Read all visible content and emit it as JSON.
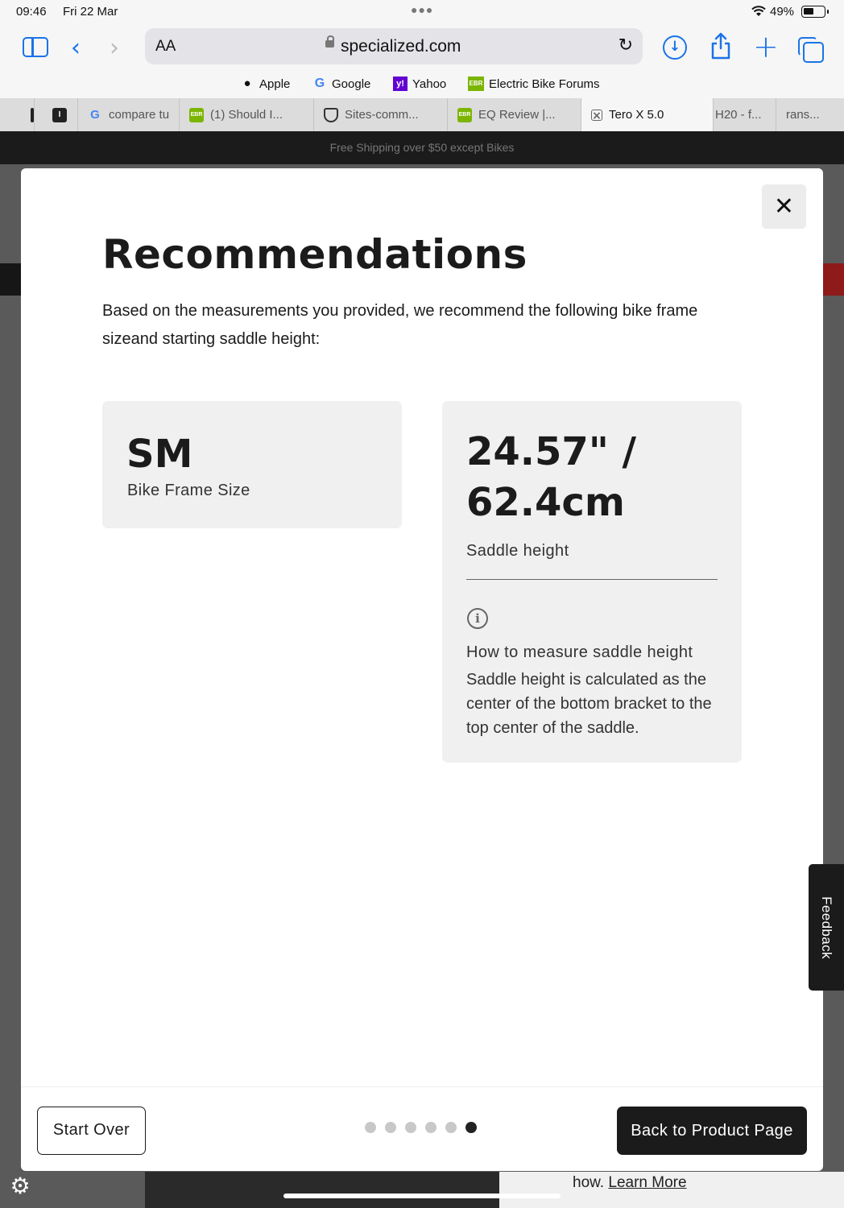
{
  "status": {
    "time": "09:46",
    "date": "Fri 22 Mar",
    "battery": "49%"
  },
  "toolbar": {
    "aa": "AA",
    "url": "specialized.com"
  },
  "favorites": [
    {
      "label": "Apple",
      "icon": "apple-icon"
    },
    {
      "label": "Google",
      "icon": "google-icon"
    },
    {
      "label": "Yahoo",
      "icon": "yahoo-icon"
    },
    {
      "label": "Electric Bike Forums",
      "icon": "ebr-icon"
    }
  ],
  "tabs": [
    {
      "label": "compare tu",
      "icon": "google-icon"
    },
    {
      "label": "(1) Should I...",
      "icon": "ebr-icon"
    },
    {
      "label": "Sites-comm...",
      "icon": "shield-icon"
    },
    {
      "label": "EQ Review |...",
      "icon": "ebr-icon"
    },
    {
      "label": "Tero X 5.0",
      "icon": "close-tab-icon",
      "active": true
    },
    {
      "label": "H20 - f..."
    },
    {
      "label": "rans..."
    }
  ],
  "page": {
    "shipping_banner": "Free Shipping over $50 except Bikes",
    "learn_prefix": "how.",
    "learn_link": "Learn More"
  },
  "modal": {
    "title": "Recommendations",
    "intro": "Based on the measurements you provided, we recommend the following bike frame sizeand starting saddle height:",
    "frame": {
      "value": "SM",
      "label": "Bike Frame Size"
    },
    "saddle": {
      "value": "24.57\" / 62.4cm",
      "label": "Saddle height",
      "how_title": "How to measure saddle height",
      "how_text": "Saddle height is calculated as the center of the bottom bracket to the top center of the saddle."
    },
    "start_over": "Start Over",
    "back": "Back to Product Page",
    "pager": {
      "total": 6,
      "current": 6
    }
  },
  "feedback": "Feedback"
}
